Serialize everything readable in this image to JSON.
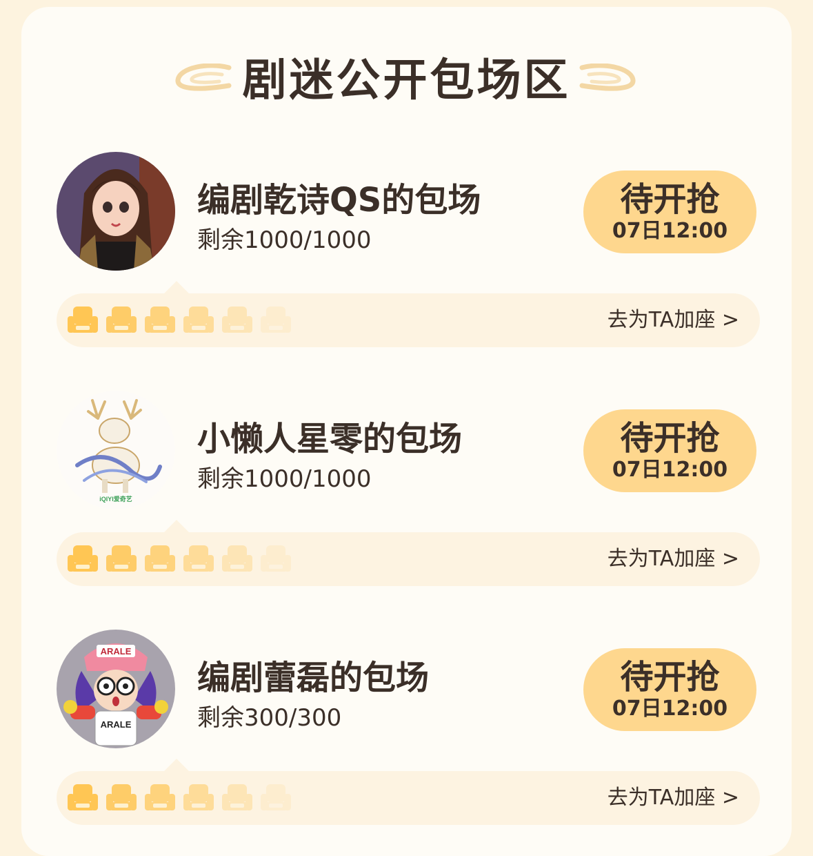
{
  "section": {
    "title": "剧迷公开包场区"
  },
  "colors": {
    "button_bg": "#fed78e",
    "seat": "#ffc654",
    "card_bg": "#fefcf6",
    "page_bg": "#fdf3df"
  },
  "entries": [
    {
      "name": "编剧乾诗QS的包场",
      "remaining": "剩余1000/1000",
      "button_label": "待开抢",
      "button_time": "07日12:00",
      "add_seat_label": "去为TA加座 >"
    },
    {
      "name": "小懒人星零的包场",
      "remaining": "剩余1000/1000",
      "button_label": "待开抢",
      "button_time": "07日12:00",
      "add_seat_label": "去为TA加座 >"
    },
    {
      "name": "编剧蕾磊的包场",
      "remaining": "剩余300/300",
      "button_label": "待开抢",
      "button_time": "07日12:00",
      "add_seat_label": "去为TA加座 >"
    }
  ],
  "avatars": [
    {
      "icon": "girl-avatar-icon"
    },
    {
      "icon": "deer-avatar-icon",
      "badge_text": "iQIYI爱奇艺"
    },
    {
      "icon": "arale-avatar-icon",
      "cap_text": "ARALE",
      "shirt_text": "ARALE"
    }
  ]
}
